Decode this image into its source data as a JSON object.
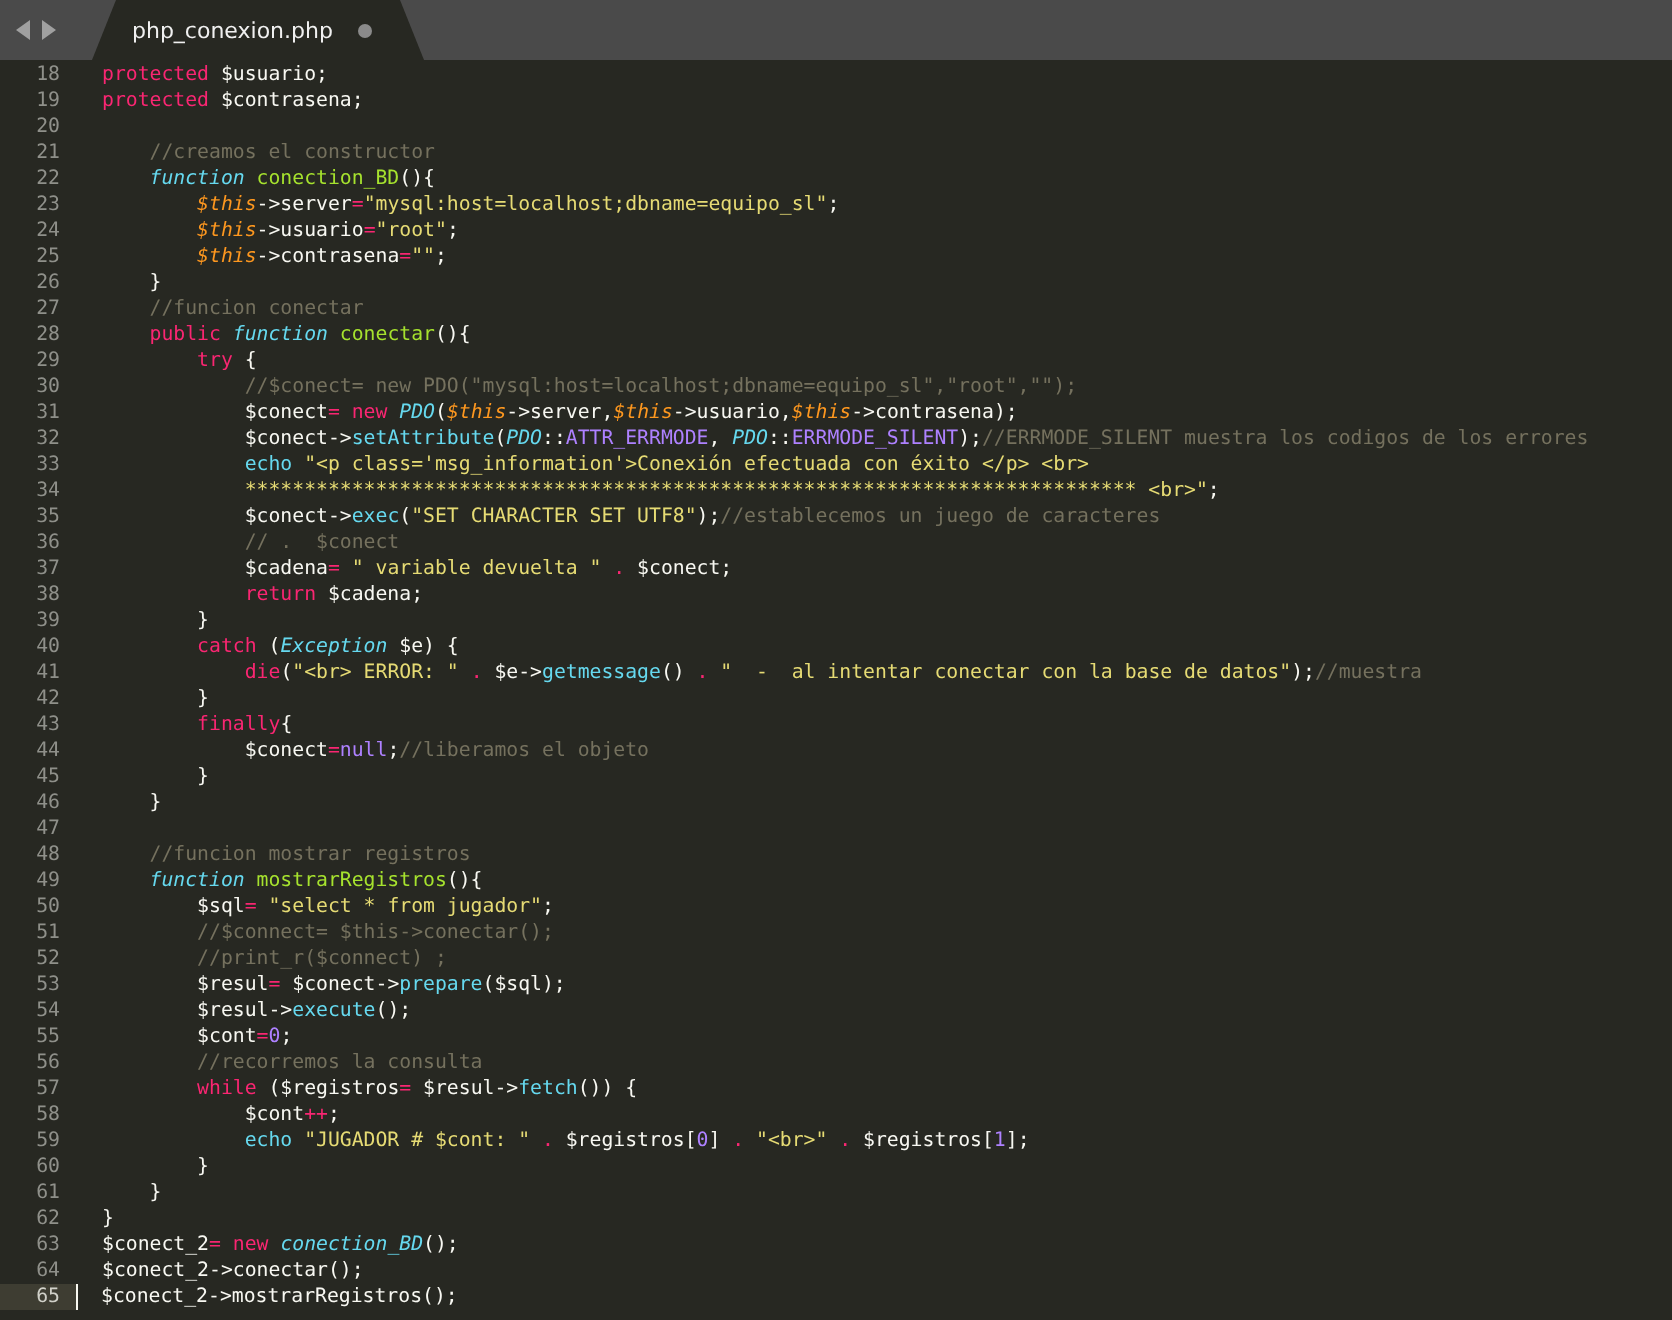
{
  "tab_bar": {
    "tabs": [
      {
        "label": "php_conexion.php",
        "selected": true,
        "modified": true
      }
    ]
  },
  "editor": {
    "lines": [
      {
        "number": "18",
        "current": false,
        "tokens": [
          {
            "kind": "keyword",
            "text": "protected"
          },
          {
            "kind": "plain",
            "text": " $usuario;"
          }
        ]
      },
      {
        "number": "19",
        "current": false,
        "tokens": [
          {
            "kind": "keyword",
            "text": "protected"
          },
          {
            "kind": "plain",
            "text": " $contrasena;"
          }
        ]
      },
      {
        "number": "20",
        "current": false
      },
      {
        "number": "21",
        "current": false,
        "tokens": [
          {
            "kind": "comment",
            "text": "    //creamos el constructor"
          }
        ]
      },
      {
        "number": "22",
        "current": false,
        "tokens": [
          {
            "kind": "type",
            "text": "    function"
          },
          {
            "kind": "function",
            "text": " conection_BD"
          },
          {
            "kind": "plain",
            "text": "(){"
          }
        ]
      },
      {
        "number": "23",
        "current": false,
        "tokens": [
          {
            "kind": "this",
            "text": "        $this"
          },
          {
            "kind": "plain",
            "text": "->server"
          },
          {
            "kind": "keyword",
            "text": "="
          },
          {
            "kind": "string",
            "text": "\"mysql:host=localhost;dbname=equipo_sl\""
          },
          {
            "kind": "plain",
            "text": ";"
          }
        ]
      },
      {
        "number": "24",
        "current": false,
        "tokens": [
          {
            "kind": "this",
            "text": "        $this"
          },
          {
            "kind": "plain",
            "text": "->usuario"
          },
          {
            "kind": "keyword",
            "text": "="
          },
          {
            "kind": "string",
            "text": "\"root\""
          },
          {
            "kind": "plain",
            "text": ";"
          }
        ]
      },
      {
        "number": "25",
        "current": false,
        "tokens": [
          {
            "kind": "this",
            "text": "        $this"
          },
          {
            "kind": "plain",
            "text": "->contrasena"
          },
          {
            "kind": "keyword",
            "text": "="
          },
          {
            "kind": "string",
            "text": "\"\""
          },
          {
            "kind": "plain",
            "text": ";"
          }
        ]
      },
      {
        "number": "26",
        "current": false,
        "tokens": [
          {
            "kind": "plain",
            "text": "    }"
          }
        ]
      },
      {
        "number": "27",
        "current": false,
        "tokens": [
          {
            "kind": "comment",
            "text": "    //funcion conectar"
          }
        ]
      },
      {
        "number": "28",
        "current": false,
        "tokens": [
          {
            "kind": "keyword",
            "text": "    public"
          },
          {
            "kind": "type",
            "text": " function"
          },
          {
            "kind": "function",
            "text": " conectar"
          },
          {
            "kind": "plain",
            "text": "(){"
          }
        ]
      },
      {
        "number": "29",
        "current": false,
        "tokens": [
          {
            "kind": "keyword",
            "text": "        try"
          },
          {
            "kind": "plain",
            "text": " {"
          }
        ]
      },
      {
        "number": "30",
        "current": false,
        "tokens": [
          {
            "kind": "comment",
            "text": "            //$conect= new PDO(\"mysql:host=localhost;dbname=equipo_sl\",\"root\",\"\");"
          }
        ]
      },
      {
        "number": "31",
        "current": false,
        "tokens": [
          {
            "kind": "plain",
            "text": "            $conect"
          },
          {
            "kind": "keyword",
            "text": "="
          },
          {
            "kind": "keyword",
            "text": " new"
          },
          {
            "kind": "type",
            "text": " PDO"
          },
          {
            "kind": "plain",
            "text": "("
          },
          {
            "kind": "this",
            "text": "$this"
          },
          {
            "kind": "plain",
            "text": "->server,"
          },
          {
            "kind": "this",
            "text": "$this"
          },
          {
            "kind": "plain",
            "text": "->usuario,"
          },
          {
            "kind": "this",
            "text": "$this"
          },
          {
            "kind": "plain",
            "text": "->contrasena);"
          }
        ]
      },
      {
        "number": "32",
        "current": false,
        "tokens": [
          {
            "kind": "plain",
            "text": "            $conect->"
          },
          {
            "kind": "method",
            "text": "setAttribute"
          },
          {
            "kind": "plain",
            "text": "("
          },
          {
            "kind": "type",
            "text": "PDO"
          },
          {
            "kind": "plain",
            "text": "::"
          },
          {
            "kind": "constant",
            "text": "ATTR_ERRMODE"
          },
          {
            "kind": "plain",
            "text": ","
          },
          {
            "kind": "type",
            "text": " PDO"
          },
          {
            "kind": "plain",
            "text": "::"
          },
          {
            "kind": "constant",
            "text": "ERRMODE_SILENT"
          },
          {
            "kind": "plain",
            "text": ");"
          },
          {
            "kind": "comment",
            "text": "//ERRMODE_SILENT muestra los codigos de los errores"
          }
        ]
      },
      {
        "number": "33",
        "current": false,
        "tokens": [
          {
            "kind": "method",
            "text": "            echo"
          },
          {
            "kind": "string",
            "text": " \"<p class='msg_information'>Conexión efectuada con éxito </p> <br>"
          }
        ]
      },
      {
        "number": "34",
        "current": false,
        "tokens": [
          {
            "kind": "string",
            "text": "            *************************************************************************** <br>\""
          },
          {
            "kind": "plain",
            "text": ";"
          }
        ]
      },
      {
        "number": "35",
        "current": false,
        "tokens": [
          {
            "kind": "plain",
            "text": "            $conect->"
          },
          {
            "kind": "method",
            "text": "exec"
          },
          {
            "kind": "plain",
            "text": "("
          },
          {
            "kind": "string",
            "text": "\"SET CHARACTER SET UTF8\""
          },
          {
            "kind": "plain",
            "text": ");"
          },
          {
            "kind": "comment",
            "text": "//establecemos un juego de caracteres"
          }
        ]
      },
      {
        "number": "36",
        "current": false,
        "tokens": [
          {
            "kind": "comment",
            "text": "            // .  $conect"
          }
        ]
      },
      {
        "number": "37",
        "current": false,
        "tokens": [
          {
            "kind": "plain",
            "text": "            $cadena"
          },
          {
            "kind": "keyword",
            "text": "="
          },
          {
            "kind": "string",
            "text": " \" variable devuelta \""
          },
          {
            "kind": "keyword",
            "text": " ."
          },
          {
            "kind": "plain",
            "text": " $conect;"
          }
        ]
      },
      {
        "number": "38",
        "current": false,
        "tokens": [
          {
            "kind": "keyword",
            "text": "            return"
          },
          {
            "kind": "plain",
            "text": " $cadena;"
          }
        ]
      },
      {
        "number": "39",
        "current": false,
        "tokens": [
          {
            "kind": "plain",
            "text": "        }"
          }
        ]
      },
      {
        "number": "40",
        "current": false,
        "tokens": [
          {
            "kind": "keyword",
            "text": "        catch"
          },
          {
            "kind": "plain",
            "text": " ("
          },
          {
            "kind": "type",
            "text": "Exception"
          },
          {
            "kind": "plain",
            "text": " $e) {"
          }
        ]
      },
      {
        "number": "41",
        "current": false,
        "tokens": [
          {
            "kind": "keyword",
            "text": "            die"
          },
          {
            "kind": "plain",
            "text": "("
          },
          {
            "kind": "string",
            "text": "\"<br> ERROR: \""
          },
          {
            "kind": "keyword",
            "text": " ."
          },
          {
            "kind": "plain",
            "text": " $e->"
          },
          {
            "kind": "method",
            "text": "getmessage"
          },
          {
            "kind": "plain",
            "text": "()"
          },
          {
            "kind": "keyword",
            "text": " ."
          },
          {
            "kind": "string",
            "text": " \"  -  al intentar conectar con la base de datos\""
          },
          {
            "kind": "plain",
            "text": ");"
          },
          {
            "kind": "comment",
            "text": "//muestra"
          }
        ]
      },
      {
        "number": "42",
        "current": false,
        "tokens": [
          {
            "kind": "plain",
            "text": "        }"
          }
        ]
      },
      {
        "number": "43",
        "current": false,
        "tokens": [
          {
            "kind": "keyword",
            "text": "        finally"
          },
          {
            "kind": "plain",
            "text": "{"
          }
        ]
      },
      {
        "number": "44",
        "current": false,
        "tokens": [
          {
            "kind": "plain",
            "text": "            $conect"
          },
          {
            "kind": "keyword",
            "text": "="
          },
          {
            "kind": "constant",
            "text": "null"
          },
          {
            "kind": "plain",
            "text": ";"
          },
          {
            "kind": "comment",
            "text": "//liberamos el objeto"
          }
        ]
      },
      {
        "number": "45",
        "current": false,
        "tokens": [
          {
            "kind": "plain",
            "text": "        }"
          }
        ]
      },
      {
        "number": "46",
        "current": false,
        "tokens": [
          {
            "kind": "plain",
            "text": "    }"
          }
        ]
      },
      {
        "number": "47",
        "current": false
      },
      {
        "number": "48",
        "current": false,
        "tokens": [
          {
            "kind": "comment",
            "text": "    //funcion mostrar registros"
          }
        ]
      },
      {
        "number": "49",
        "current": false,
        "tokens": [
          {
            "kind": "type",
            "text": "    function"
          },
          {
            "kind": "function",
            "text": " mostrarRegistros"
          },
          {
            "kind": "plain",
            "text": "(){"
          }
        ]
      },
      {
        "number": "50",
        "current": false,
        "tokens": [
          {
            "kind": "plain",
            "text": "        $sql"
          },
          {
            "kind": "keyword",
            "text": "="
          },
          {
            "kind": "string",
            "text": " \"select * from jugador\""
          },
          {
            "kind": "plain",
            "text": ";"
          }
        ]
      },
      {
        "number": "51",
        "current": false,
        "tokens": [
          {
            "kind": "comment",
            "text": "        //$connect= $this->conectar();"
          }
        ]
      },
      {
        "number": "52",
        "current": false,
        "tokens": [
          {
            "kind": "comment",
            "text": "        //print_r($connect) ;"
          }
        ]
      },
      {
        "number": "53",
        "current": false,
        "tokens": [
          {
            "kind": "plain",
            "text": "        $resul"
          },
          {
            "kind": "keyword",
            "text": "="
          },
          {
            "kind": "plain",
            "text": " $conect->"
          },
          {
            "kind": "method",
            "text": "prepare"
          },
          {
            "kind": "plain",
            "text": "($sql);"
          }
        ]
      },
      {
        "number": "54",
        "current": false,
        "tokens": [
          {
            "kind": "plain",
            "text": "        $resul->"
          },
          {
            "kind": "method",
            "text": "execute"
          },
          {
            "kind": "plain",
            "text": "();"
          }
        ]
      },
      {
        "number": "55",
        "current": false,
        "tokens": [
          {
            "kind": "plain",
            "text": "        $cont"
          },
          {
            "kind": "keyword",
            "text": "="
          },
          {
            "kind": "constant",
            "text": "0"
          },
          {
            "kind": "plain",
            "text": ";"
          }
        ]
      },
      {
        "number": "56",
        "current": false,
        "tokens": [
          {
            "kind": "comment",
            "text": "        //recorremos la consulta"
          }
        ]
      },
      {
        "number": "57",
        "current": false,
        "tokens": [
          {
            "kind": "keyword",
            "text": "        while"
          },
          {
            "kind": "plain",
            "text": " ($registros"
          },
          {
            "kind": "keyword",
            "text": "="
          },
          {
            "kind": "plain",
            "text": " $resul->"
          },
          {
            "kind": "method",
            "text": "fetch"
          },
          {
            "kind": "plain",
            "text": "()) {"
          }
        ]
      },
      {
        "number": "58",
        "current": false,
        "tokens": [
          {
            "kind": "plain",
            "text": "            $cont"
          },
          {
            "kind": "keyword",
            "text": "++"
          },
          {
            "kind": "plain",
            "text": ";"
          }
        ]
      },
      {
        "number": "59",
        "current": false,
        "tokens": [
          {
            "kind": "method",
            "text": "            echo"
          },
          {
            "kind": "string",
            "text": " \"JUGADOR # $cont: \""
          },
          {
            "kind": "keyword",
            "text": " ."
          },
          {
            "kind": "plain",
            "text": " $registros["
          },
          {
            "kind": "constant",
            "text": "0"
          },
          {
            "kind": "plain",
            "text": "]"
          },
          {
            "kind": "keyword",
            "text": " ."
          },
          {
            "kind": "string",
            "text": " \"<br>\""
          },
          {
            "kind": "keyword",
            "text": " ."
          },
          {
            "kind": "plain",
            "text": " $registros["
          },
          {
            "kind": "constant",
            "text": "1"
          },
          {
            "kind": "plain",
            "text": "];"
          }
        ]
      },
      {
        "number": "60",
        "current": false,
        "tokens": [
          {
            "kind": "plain",
            "text": "        }"
          }
        ]
      },
      {
        "number": "61",
        "current": false,
        "tokens": [
          {
            "kind": "plain",
            "text": "    }"
          }
        ]
      },
      {
        "number": "62",
        "current": false,
        "tokens": [
          {
            "kind": "plain",
            "text": "}"
          }
        ]
      },
      {
        "number": "63",
        "current": false,
        "tokens": [
          {
            "kind": "plain",
            "text": "$conect_2"
          },
          {
            "kind": "keyword",
            "text": "="
          },
          {
            "kind": "keyword",
            "text": " new"
          },
          {
            "kind": "type",
            "text": " conection_BD"
          },
          {
            "kind": "plain",
            "text": "();"
          }
        ]
      },
      {
        "number": "64",
        "current": false,
        "tokens": [
          {
            "kind": "plain",
            "text": "$conect_2->conectar();"
          }
        ]
      },
      {
        "number": "65",
        "current": true,
        "tokens": [
          {
            "kind": "plain",
            "text": "$conect_2->mostrarRegistros();"
          }
        ]
      }
    ]
  }
}
